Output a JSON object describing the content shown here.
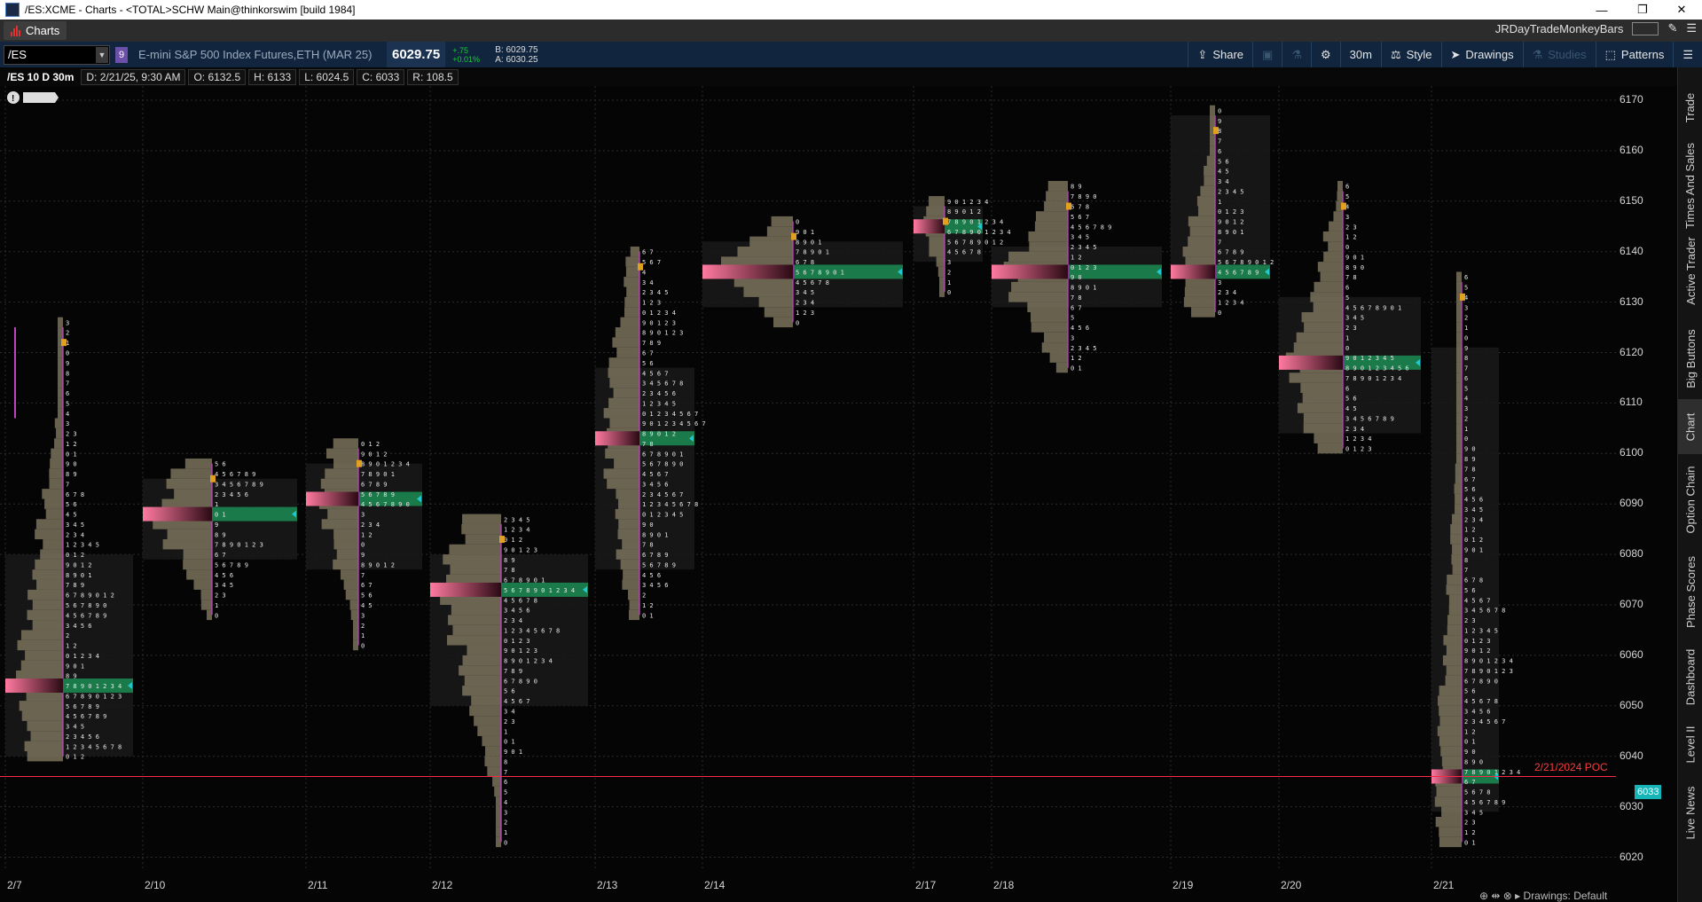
{
  "window": {
    "title": "/ES:XCME - Charts - <TOTAL>SCHW Main@thinkorswim [build 1984]"
  },
  "menubar": {
    "tab_label": "Charts",
    "script_name": "JRDayTradeMonkeyBars"
  },
  "toolbar": {
    "symbol": "/ES",
    "link_group": "9",
    "description": "E-mini S&P 500 Index Futures,ETH (MAR 25)",
    "last": "6029.75",
    "net_change": "+.75",
    "pct_change": "+0.01%",
    "bid": "B: 6029.75",
    "ask": "A: 6030.25",
    "share_label": "Share",
    "aggregation": "30m",
    "style_label": "Style",
    "drawings_label": "Drawings",
    "studies_label": "Studies",
    "patterns_label": "Patterns"
  },
  "infobar": {
    "symbol_period": "/ES 10 D 30m",
    "date": "D: 2/21/25, 9:30 AM",
    "open": "O: 6132.5",
    "high": "H: 6133",
    "low": "L: 6024.5",
    "close": "C: 6033",
    "range": "R: 108.5"
  },
  "sidebar": {
    "tabs": [
      "Trade",
      "Times And Sales",
      "Active Trader",
      "Big Buttons",
      "Chart",
      "Option Chain",
      "Phase Scores",
      "Dashboard",
      "Level II",
      "Live News"
    ],
    "active": "Chart"
  },
  "chart_data": {
    "type": "market-profile",
    "instrument": "/ES",
    "ylim": [
      6017,
      6174
    ],
    "y_ticks": [
      6020,
      6030,
      6040,
      6050,
      6060,
      6070,
      6080,
      6090,
      6100,
      6110,
      6120,
      6130,
      6140,
      6150,
      6160,
      6170
    ],
    "x_ticks": [
      "2/7",
      "2/10",
      "2/11",
      "2/12",
      "2/13",
      "2/14",
      "2/17",
      "2/18",
      "2/19",
      "2/20",
      "2/21"
    ],
    "last_price": "6033",
    "poc_line": {
      "label": "2/21/2024 POC",
      "price": 6036
    },
    "sessions": [
      {
        "date": "2/7",
        "low": 6040,
        "high": 6125,
        "poc": 6054,
        "va_low": 6040,
        "va_high": 6080
      },
      {
        "date": "2/10",
        "low": 6068,
        "high": 6098,
        "poc": 6088,
        "va_low": 6079,
        "va_high": 6095
      },
      {
        "date": "2/11",
        "low": 6062,
        "high": 6101,
        "poc": 6091,
        "va_low": 6077,
        "va_high": 6098
      },
      {
        "date": "2/12",
        "low": 6023,
        "high": 6086,
        "poc": 6073,
        "va_low": 6050,
        "va_high": 6080
      },
      {
        "date": "2/13",
        "low": 6068,
        "high": 6140,
        "poc": 6103,
        "va_low": 6077,
        "va_high": 6117
      },
      {
        "date": "2/14",
        "low": 6126,
        "high": 6146,
        "poc": 6136,
        "va_low": 6129,
        "va_high": 6142
      },
      {
        "date": "2/17",
        "low": 6132,
        "high": 6149,
        "poc": 6145,
        "va_low": 6138,
        "va_high": 6149
      },
      {
        "date": "2/18",
        "low": 6117,
        "high": 6152,
        "poc": 6136,
        "va_low": 6129,
        "va_high": 6141
      },
      {
        "date": "2/19",
        "low": 6128,
        "high": 6167,
        "poc": 6136,
        "va_low": 6135,
        "va_high": 6167
      },
      {
        "date": "2/20",
        "low": 6101,
        "high": 6152,
        "poc": 6118,
        "va_low": 6104,
        "va_high": 6131
      },
      {
        "date": "2/21",
        "low": 6023,
        "high": 6134,
        "poc": 6036,
        "va_low": 6029,
        "va_high": 6121
      }
    ]
  },
  "footer": {
    "controls": "⊕ ⇹ ⊗ ▸ Drawings: Default"
  }
}
